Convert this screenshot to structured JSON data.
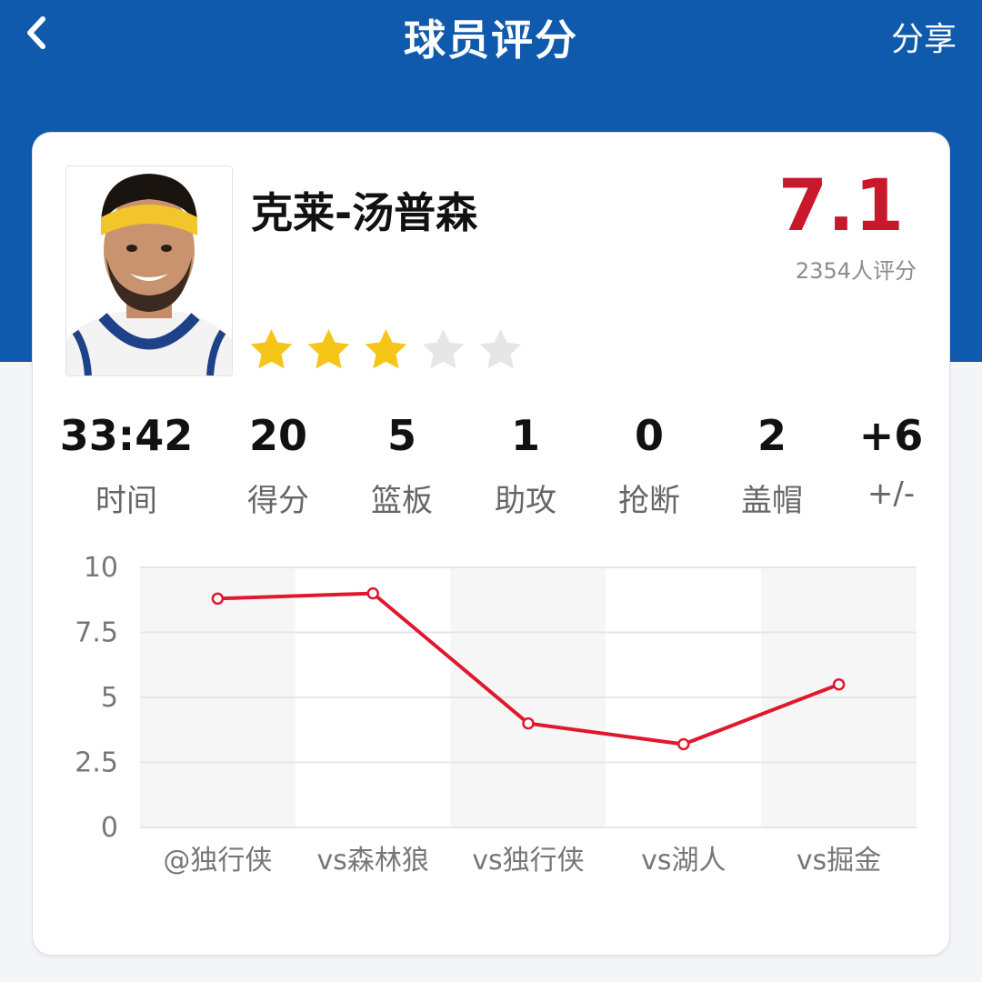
{
  "header": {
    "title": "球员评分",
    "share_label": "分享",
    "back_icon": "chevron-left-icon"
  },
  "player": {
    "name": "克莱-汤普森",
    "rating": "7.1",
    "rating_count": "2354人评分",
    "stars": [
      {
        "filled": true
      },
      {
        "filled": true
      },
      {
        "filled": true
      },
      {
        "filled": false
      },
      {
        "filled": false
      }
    ],
    "stars_filled": 3,
    "stars_total": 5
  },
  "stats": [
    {
      "value": "33:42",
      "label": "时间"
    },
    {
      "value": "20",
      "label": "得分"
    },
    {
      "value": "5",
      "label": "篮板"
    },
    {
      "value": "1",
      "label": "助攻"
    },
    {
      "value": "0",
      "label": "抢断"
    },
    {
      "value": "2",
      "label": "盖帽"
    },
    {
      "value": "+6",
      "label": "+/-"
    }
  ],
  "colors": {
    "header_blue": "#0f5aad",
    "rating_red": "#c8182b",
    "star_gold": "#f5c518",
    "star_gray": "#e6e6e6",
    "line_red": "#e0182e"
  },
  "chart_data": {
    "type": "line",
    "categories": [
      "@独行侠",
      "vs森林狼",
      "vs独行侠",
      "vs湖人",
      "vs掘金"
    ],
    "series": [
      {
        "values": [
          8.8,
          9.0,
          4.0,
          3.2,
          5.5
        ]
      }
    ],
    "ylim": [
      0,
      10
    ],
    "yticks": [
      "0",
      "2.5",
      "5",
      "7.5",
      "10"
    ],
    "grid": true
  }
}
